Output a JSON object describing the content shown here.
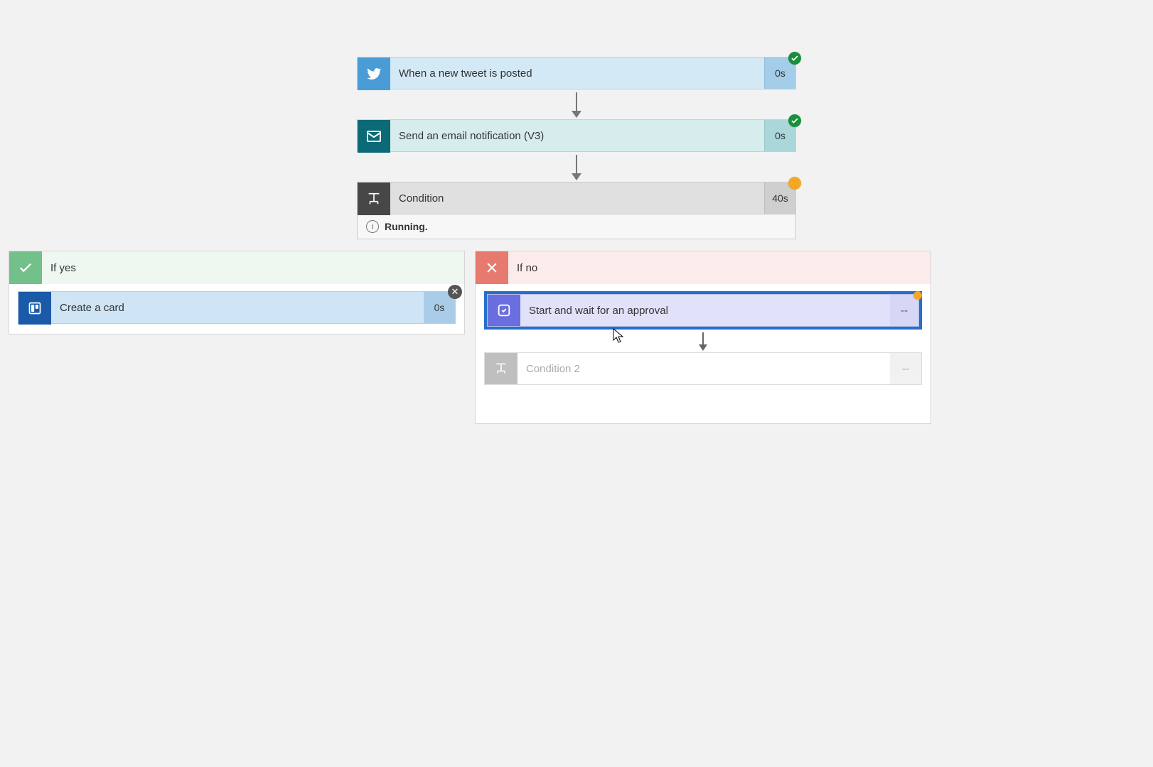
{
  "flow": {
    "trigger": {
      "label": "When a new tweet is posted",
      "time": "0s",
      "status": "success"
    },
    "email": {
      "label": "Send an email notification (V3)",
      "time": "0s",
      "status": "success"
    },
    "condition": {
      "label": "Condition",
      "time": "40s",
      "status": "running",
      "status_text": "Running."
    }
  },
  "branches": {
    "yes": {
      "header": "If yes",
      "trello": {
        "label": "Create a card",
        "time": "0s"
      }
    },
    "no": {
      "header": "If no",
      "approval": {
        "label": "Start and wait for an approval",
        "time": "--",
        "status": "pending"
      },
      "condition2": {
        "label": "Condition 2",
        "time": "--"
      }
    }
  }
}
